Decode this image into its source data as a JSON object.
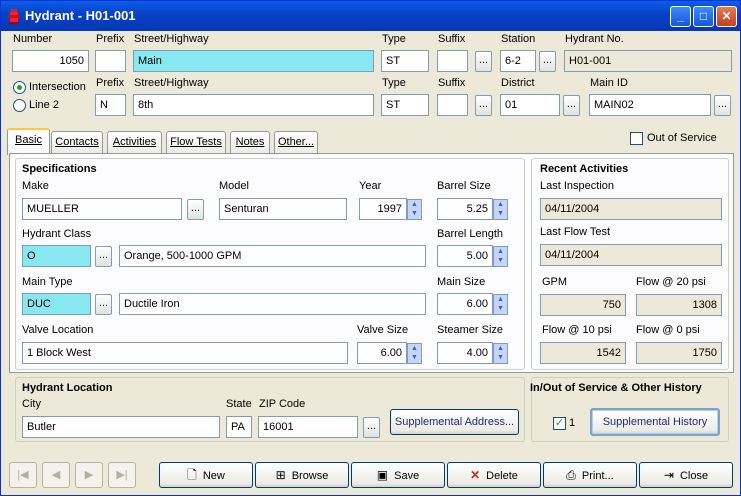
{
  "window": {
    "title": "Hydrant  - H01-001"
  },
  "row1": {
    "number_label": "Number",
    "number": "1050",
    "prefix_label": "Prefix",
    "prefix": "",
    "street_label": "Street/Highway",
    "street": "Main",
    "type_label": "Type",
    "type": "ST",
    "suffix_label": "Suffix",
    "suffix": "",
    "station_label": "Station",
    "station": "6-2",
    "hydrant_no_label": "Hydrant No.",
    "hydrant_no": "H01-001"
  },
  "row2": {
    "intersection_label": "Intersection",
    "line2_label": "Line 2",
    "prefix_label": "Prefix",
    "prefix": "N",
    "street_label": "Street/Highway",
    "street": "8th",
    "type_label": "Type",
    "type": "ST",
    "suffix_label": "Suffix",
    "suffix": "",
    "district_label": "District",
    "district": "01",
    "main_id_label": "Main ID",
    "main_id": "MAIN02"
  },
  "tabs": [
    "Basic",
    "Contacts",
    "Activities",
    "Flow Tests",
    "Notes",
    "Other..."
  ],
  "out_of_service_label": "Out of Service",
  "specs": {
    "title": "Specifications",
    "make_label": "Make",
    "make": "MUELLER",
    "model_label": "Model",
    "model": "Senturan",
    "year_label": "Year",
    "year": "1997",
    "barrel_size_label": "Barrel Size",
    "barrel_size": "5.25",
    "hydrant_class_label": "Hydrant Class",
    "hydrant_class": "O",
    "hydrant_class_desc": "Orange, 500-1000 GPM",
    "barrel_length_label": "Barrel Length",
    "barrel_length": "5.00",
    "main_type_label": "Main Type",
    "main_type": "DUC",
    "main_type_desc": "Ductile Iron",
    "main_size_label": "Main Size",
    "main_size": "6.00",
    "valve_location_label": "Valve Location",
    "valve_location": "1 Block West",
    "valve_size_label": "Valve Size",
    "valve_size": "6.00",
    "steamer_size_label": "Steamer Size",
    "steamer_size": "4.00"
  },
  "recent": {
    "title": "Recent Activities",
    "last_inspection_label": "Last Inspection",
    "last_inspection": "04/11/2004",
    "last_flow_test_label": "Last Flow Test",
    "last_flow_test": "04/11/2004",
    "gpm_label": "GPM",
    "gpm": "750",
    "flow20_label": "Flow @ 20 psi",
    "flow20": "1308",
    "flow10_label": "Flow @ 10 psi",
    "flow10": "1542",
    "flow0_label": "Flow @ 0 psi",
    "flow0": "1750"
  },
  "location": {
    "title": "Hydrant Location",
    "city_label": "City",
    "city": "Butler",
    "state_label": "State",
    "state": "PA",
    "zip_label": "ZIP Code",
    "zip": "16001",
    "supp_address_button": "Supplemental Address..."
  },
  "history": {
    "title": "In/Out of Service & Other History",
    "check_label": "1",
    "supp_history_button": "Supplemental History"
  },
  "buttons": {
    "new": "New",
    "browse": "Browse",
    "save": "Save",
    "delete": "Delete",
    "print": "Print...",
    "close": "Close"
  },
  "colors": {
    "titlebar": "#0842c8",
    "highlight_field": "#88e8f2",
    "window_bg": "#ece9d8"
  }
}
